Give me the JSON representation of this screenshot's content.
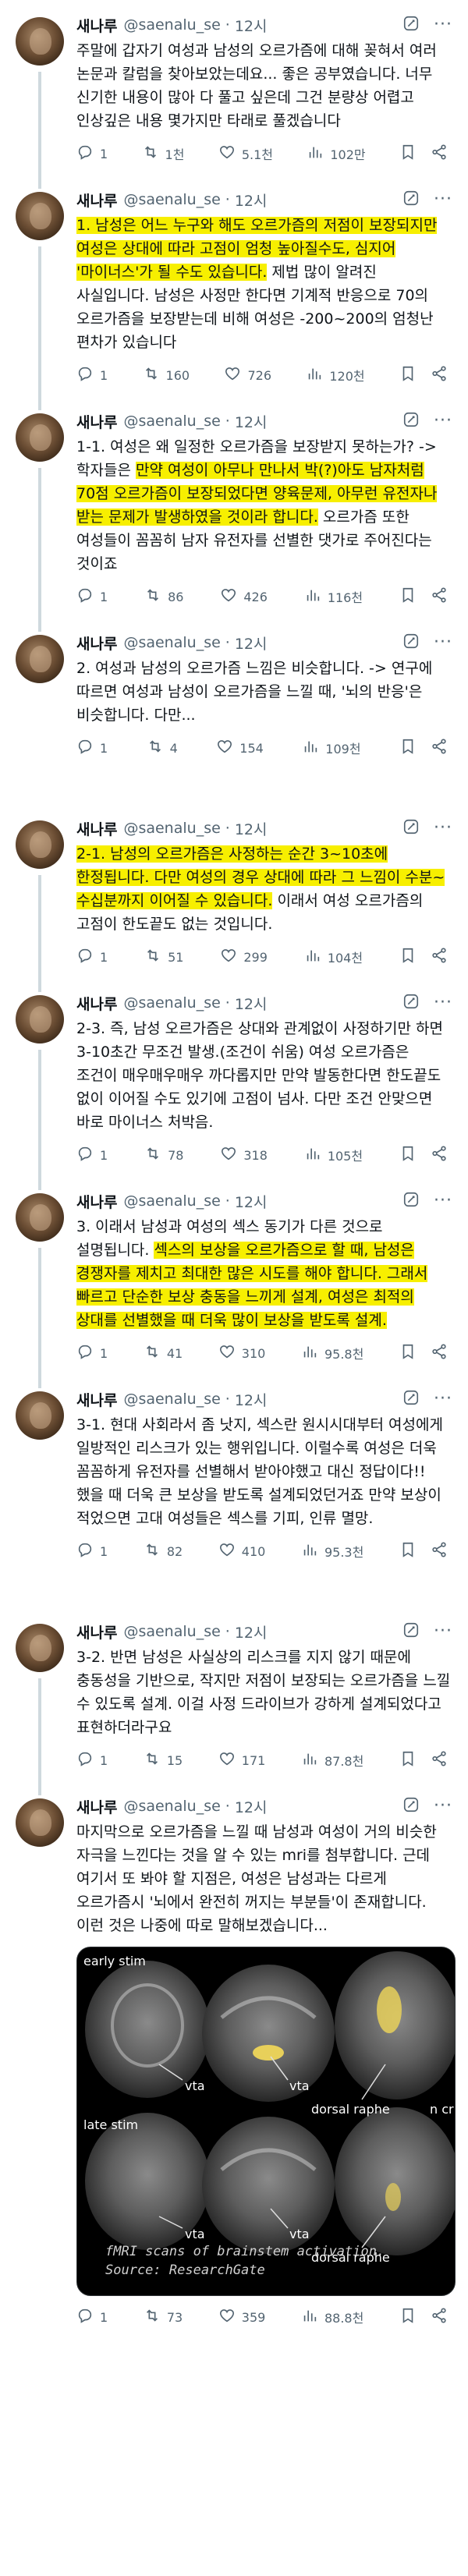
{
  "author": {
    "name": "새나루",
    "handle": "@saenalu_se",
    "time": "12시"
  },
  "colors": {
    "highlight": "#f7ef00",
    "muted": "#536471",
    "thread_line": "#cfd9de"
  },
  "icons": [
    "grok-icon",
    "more-icon",
    "reply-icon",
    "retweet-icon",
    "like-icon",
    "views-icon",
    "bookmark-icon",
    "share-icon"
  ],
  "tweets": [
    {
      "segments": [
        {
          "t": "주말에 갑자기 여성과 남성의 오르가즘에 대해 꽂혀서 여러 논문과 칼럼을 찾아보았는데요... 좋은 공부였습니다. 너무 신기한 내용이 많아 다 풀고 싶은데 그건 분량상 어렵고 인상깊은 내용 몇가지만 타래로 풀겠습니다",
          "hl": false
        }
      ],
      "stats": {
        "reply": "1",
        "retweet": "1천",
        "like": "5.1천",
        "views": "102만"
      }
    },
    {
      "segments": [
        {
          "t": "1. 남성은 어느 누구와 해도 오르가즘의 저점이 보장되지만 여성은 상대에 따라 고점이 엄청 높아질수도, 심지어 '마이너스'가 될 수도 있습니다.",
          "hl": true
        },
        {
          "t": " 제법 많이 알려진 사실입니다. 남성은 사정만 한다면 기계적 반응으로 70의 오르가즘을 보장받는데 비해 여성은 -200~200의 엄청난 편차가 있습니다",
          "hl": false
        }
      ],
      "stats": {
        "reply": "1",
        "retweet": "160",
        "like": "726",
        "views": "120천"
      }
    },
    {
      "segments": [
        {
          "t": "1-1. 여성은 왜 일정한 오르가즘을 보장받지 못하는가? -> 학자들은 ",
          "hl": false
        },
        {
          "t": "만약 여성이 아무나 만나서 박(?)아도 남자처럼 70점 오르가즘이 보장되었다면 양육문제, 아무런 유전자나 받는 문제가 발생하였을 것이라 합니다.",
          "hl": true
        },
        {
          "t": " 오르가즘 또한 여성들이 꼼꼼히 남자 유전자를 선별한 댓가로 주어진다는 것이죠",
          "hl": false
        }
      ],
      "stats": {
        "reply": "1",
        "retweet": "86",
        "like": "426",
        "views": "116천"
      }
    },
    {
      "segments": [
        {
          "t": "2. 여성과 남성의 오르가즘 느낌은 비슷합니다. -> 연구에 따르면 여성과 남성이 오르가즘을 느낄 때, '뇌의 반응'은 비슷합니다. 다만...",
          "hl": false
        }
      ],
      "stats": {
        "reply": "1",
        "retweet": "4",
        "like": "154",
        "views": "109천"
      }
    },
    {
      "gap": true,
      "segments": [
        {
          "t": "2-1. 남성의 오르가즘은 사정하는 순간 3~10초에 한정됩니다. 다만 여성의 경우 상대에 따라 그 느낌이 수분~수십분까지 이어질 수 있습니다.",
          "hl": true
        },
        {
          "t": " 이래서 여성 오르가즘의 고점이 한도끝도 없는 것입니다.",
          "hl": false
        }
      ],
      "stats": {
        "reply": "1",
        "retweet": "51",
        "like": "299",
        "views": "104천"
      }
    },
    {
      "segments": [
        {
          "t": "2-3. 즉, 남성 오르가즘은 상대와 관계없이 사정하기만 하면 3-10초간 무조건 발생.(조건이 쉬움) 여성 오르가즘은 조건이 매우매우매우 까다롭지만 만약 발동한다면 한도끝도 없이 이어질 수도 있기에 고점이 넘사. 다만 조건 안맞으면 바로 마이너스 처박음.",
          "hl": false
        }
      ],
      "stats": {
        "reply": "1",
        "retweet": "78",
        "like": "318",
        "views": "105천"
      }
    },
    {
      "segments": [
        {
          "t": "3. 이래서 남성과 여성의 섹스 동기가 다른 것으로 설명됩니다. ",
          "hl": false
        },
        {
          "t": "섹스의 보상을 오르가즘으로 할 때, 남성은 경쟁자를 제치고 최대한 많은 시도를 해야 합니다. 그래서 빠르고 단순한 보상 충동을 느끼게 설계, 여성은 최적의 상대를 선별했을 때 더욱 많이 보상을 받도록 설계.",
          "hl": true
        }
      ],
      "stats": {
        "reply": "1",
        "retweet": "41",
        "like": "310",
        "views": "95.8천"
      }
    },
    {
      "segments": [
        {
          "t": "3-1. 현대 사회라서 좀 낫지, 섹스란 원시시대부터 여성에게 일방적인 리스크가 있는 행위입니다. 이럴수록 여성은 더욱 꼼꼼하게 유전자를 선별해서 받아야했고 대신 정답이다!! 했을 때 더욱 큰 보상을 받도록 설계되었던거죠 만약 보상이 적었으면 고대 여성들은 섹스를 기피, 인류 멸망.",
          "hl": false
        }
      ],
      "stats": {
        "reply": "1",
        "retweet": "82",
        "like": "410",
        "views": "95.3천"
      }
    },
    {
      "gap": true,
      "segments": [
        {
          "t": "3-2. 반면 남성은 사실상의 리스크를 지지 않기 때문에 충동성을 기반으로, 작지만 저점이 보장되는 오르가즘을 느낄 수 있도록 설계. 이걸 사정 드라이브가 강하게 설계되었다고 표현하더라구요",
          "hl": false
        }
      ],
      "stats": {
        "reply": "1",
        "retweet": "15",
        "like": "171",
        "views": "87.8천"
      }
    },
    {
      "segments": [
        {
          "t": "마지막으로 오르가즘을 느낄 때 남성과 여성이 거의 비슷한 자극을 느낀다는 것을 알 수 있는 mri를 첨부합니다. 근데 여기서 또 봐야 할 지점은, 여성은 남성과는 다르게 오르가즘시 '뇌에서 완전히 꺼지는 부분들'이 존재합니다. 이런 것은 나중에 따로 말해보겠습니다...",
          "hl": false
        }
      ],
      "media": {
        "labels": {
          "early": "early stim",
          "late": "late stim",
          "vta": "vta",
          "dorsal": "dorsal raphe",
          "ncr": "n cr"
        },
        "caption_line1": "fMRI scans of brainstem activation.",
        "caption_line2": "Source: ResearchGate"
      },
      "stats": {
        "reply": "1",
        "retweet": "73",
        "like": "359",
        "views": "88.8천"
      }
    }
  ]
}
